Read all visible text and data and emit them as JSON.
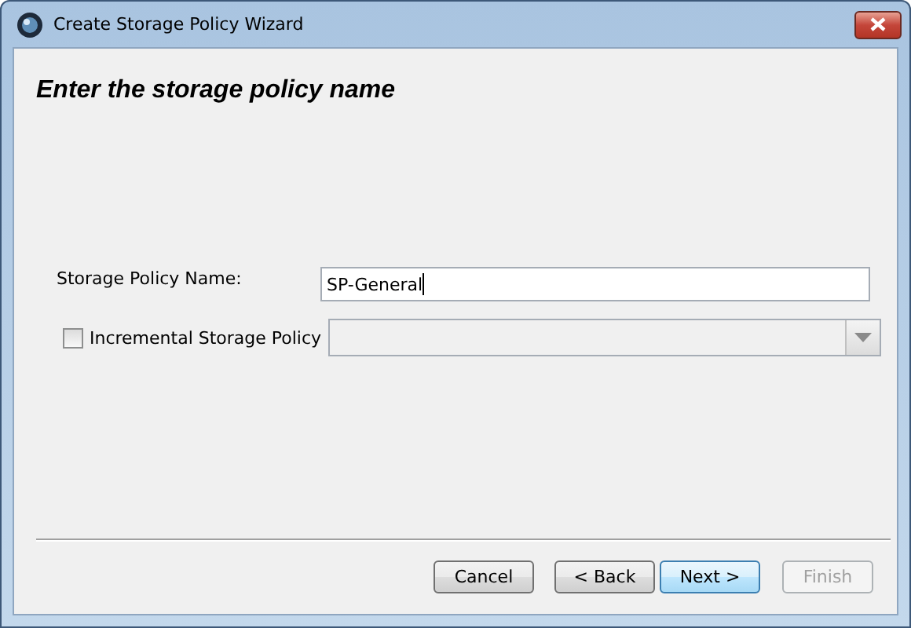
{
  "window": {
    "title": "Create Storage Policy Wizard"
  },
  "heading": "Enter the storage policy name",
  "name_field": {
    "label": "Storage Policy Name:",
    "value": "SP-General",
    "focused": true
  },
  "incremental": {
    "label": "Incremental Storage Policy",
    "checked": false
  },
  "policy_dropdown": {
    "disabled": true
  },
  "buttons": [
    {
      "label": "Cancel",
      "disabled": false,
      "default": false
    },
    {
      "label": "< Back",
      "disabled": false,
      "default": false
    },
    {
      "label": "Next >",
      "disabled": false,
      "default": true
    },
    {
      "label": "Finish",
      "disabled": true,
      "default": false
    }
  ]
}
